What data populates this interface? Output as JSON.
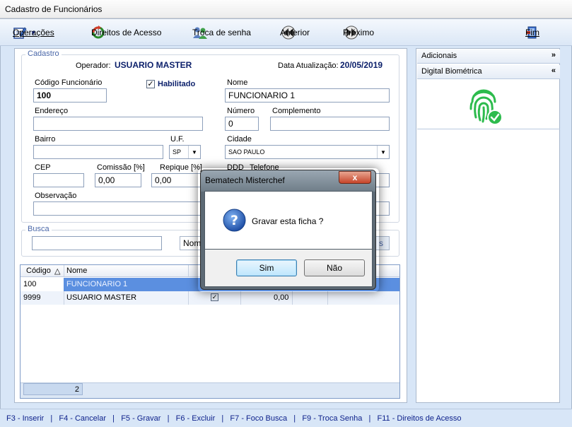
{
  "window": {
    "title": "Cadastro de Funcionários"
  },
  "toolbar": {
    "operacoes": "Operações",
    "direitos": "Direitos de Acesso",
    "troca_senha": "Troca de senha",
    "anterior": "Anterior",
    "proximo": "Próximo",
    "fim": "Fim"
  },
  "cadastro": {
    "group_title": "Cadastro",
    "operador_label": "Operador:",
    "operador_value": "USUARIO MASTER",
    "data_label": "Data Atualização:",
    "data_value": "20/05/2019",
    "codigo_label": "Código Funcionário",
    "codigo_value": "100",
    "habilitado_label": "Habilitado",
    "habilitado_checked": true,
    "nome_label": "Nome",
    "nome_value": "FUNCIONARIO 1",
    "endereco_label": "Endereço",
    "endereco_value": "",
    "numero_label": "Número",
    "numero_value": "0",
    "complemento_label": "Complemento",
    "complemento_value": "",
    "bairro_label": "Bairro",
    "bairro_value": "",
    "uf_label": "U.F.",
    "uf_value": "SP",
    "cidade_label": "Cidade",
    "cidade_value": "SAO PAULO",
    "cep_label": "CEP",
    "cep_value": "",
    "comissao_label": "Comissão [%]",
    "comissao_value": "0,00",
    "repique_label": "Repique [%]",
    "repique_value": "0,00",
    "ddd_label": "DDD",
    "telefone_label": "Telefone",
    "observacao_label": "Observação",
    "observacao_value": ""
  },
  "busca": {
    "group_title": "Busca",
    "value": "",
    "nome_fragment": "Nom",
    "right_fragment": "s"
  },
  "grid": {
    "columns": [
      "Código",
      "Nome"
    ],
    "sort_indicator": "△",
    "rows": [
      {
        "codigo": "100",
        "nome": "FUNCIONARIO 1",
        "valor": ""
      },
      {
        "codigo": "9999",
        "nome": "USUARIO MASTER",
        "checked": true,
        "valor": "0,00"
      }
    ],
    "footer_count": "2"
  },
  "right_panel": {
    "adicionais": "Adicionais",
    "digital": "Digital Biométrica"
  },
  "statusbar": {
    "text": "F3 - Inserir   |   F4 - Cancelar   |   F5 - Gravar   |   F6 - Excluir   |   F7 - Foco Busca   |   F9 - Troca Senha   |   F11 - Direitos de Acesso"
  },
  "dialog": {
    "title": "Bematech Misterchef",
    "close": "x",
    "message": "Gravar esta ficha ?",
    "sim": "Sim",
    "nao": "Não"
  },
  "colors": {
    "accent": "#0b1f8a",
    "selected_row": "#5b8fe0",
    "fingerprint": "#2dbb4d"
  }
}
